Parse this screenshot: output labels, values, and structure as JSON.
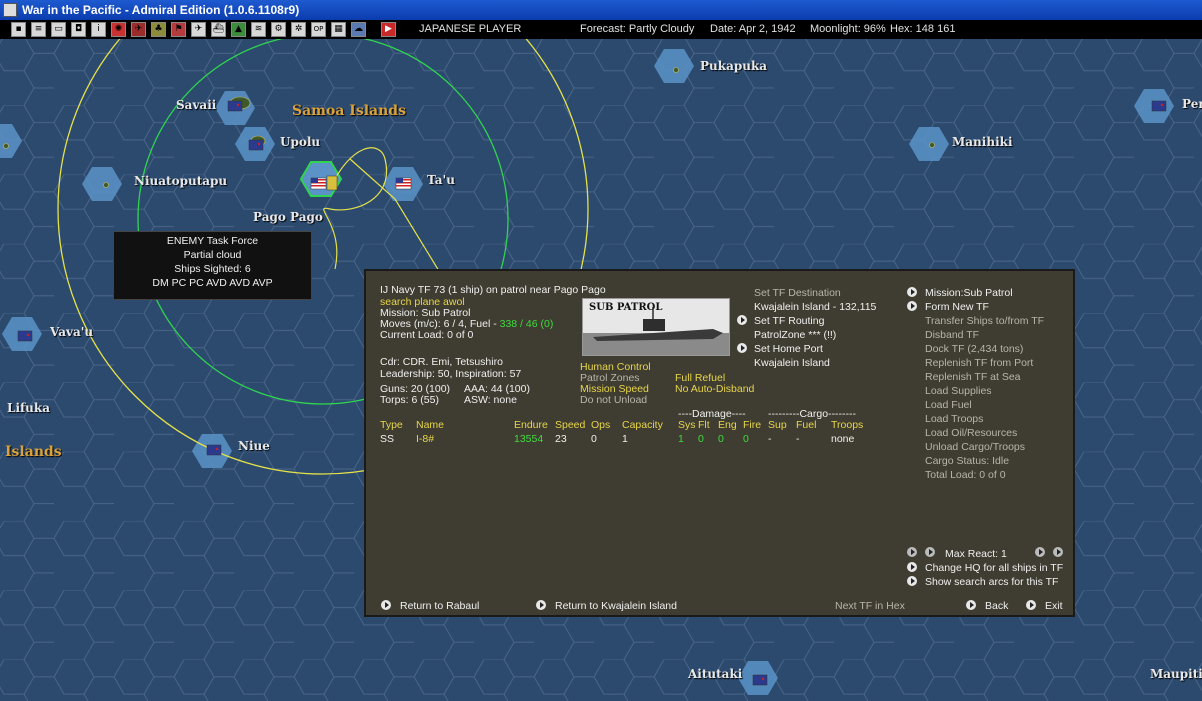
{
  "window": {
    "title": "War in the Pacific - Admiral Edition (1.0.6.1108r9)"
  },
  "toolbar": {
    "player": "JAPANESE PLAYER",
    "forecast": "Forecast: Partly Cloudy",
    "date": "Date: Apr 2, 1942",
    "moonlight": "Moonlight: 96%",
    "hex": "Hex: 148 161"
  },
  "map": {
    "labels": {
      "savaii": "Savaii",
      "samoa": "Samoa Islands",
      "upolu": "Upolu",
      "niuatoputapu": "Niuatoputapu",
      "tau": "Ta'u",
      "pago_pago": "Pago Pago",
      "pukapuka": "Pukapuka",
      "manihiki": "Manihiki",
      "per": "Pen",
      "vavau": "Vava'u",
      "lifuka": "Lifuka",
      "islands": "Islands",
      "niue": "Niue",
      "aitutaki": "Aitutaki",
      "maupiti": "Maupiti"
    }
  },
  "tooltip": {
    "line1": "ENEMY Task Force",
    "line2": "Partial cloud",
    "line3": "Ships Sighted: 6",
    "line4": "DM PC PC AVD AVD AVP"
  },
  "tf_panel": {
    "header": "IJ Navy TF 73 (1 ship)  on patrol near Pago Pago",
    "status": "search plane awol",
    "mission": "Mission: Sub Patrol",
    "moves_prefix": "Moves (m/c): 6 / 4, Fuel - ",
    "fuel": "338 / 46 (0)",
    "current_load": "Current Load:  0 of 0",
    "cdr": "Cdr: CDR. Emi, Tetsushiro",
    "leadership": "Leadership: 50, Inspiration: 57",
    "guns": "Guns: 20 (100)",
    "aaa": "AAA: 44 (100)",
    "torps": "Torps: 6 (55)",
    "asw": "ASW: none",
    "image_label": "SUB PATROL",
    "opt_human": "Human Control",
    "opt_patrol": "Patrol Zones",
    "opt_speed": "Mission Speed",
    "opt_unload": "Do not Unload",
    "opt_refuel": "Full Refuel",
    "opt_disband": "No Auto-Disband",
    "dest_title": "Set TF Destination",
    "dest": "Kwajalein Island - 132,115",
    "routing": "Set TF Routing",
    "patrol_zone": "PatrolZone *** (!!)",
    "home_port": "Set Home Port",
    "home": "Kwajalein Island",
    "right_menu": [
      "Mission:Sub Patrol",
      "Form New TF",
      "Transfer Ships to/from TF",
      "Disband TF",
      "Dock TF (2,434 tons)",
      "Replenish TF from Port",
      "Replenish TF at Sea",
      "Load Supplies",
      "Load Fuel",
      "Load Troops",
      "Load Oil/Resources",
      "Unload Cargo/Troops",
      "Cargo Status: Idle",
      "Total Load: 0 of 0"
    ],
    "damage_header": "----Damage----",
    "cargo_header": "---------Cargo--------",
    "columns": [
      "Type",
      "Name",
      "Endure",
      "Speed",
      "Ops",
      "Capacity",
      "Sys",
      "Flt",
      "Eng",
      "Fire",
      "Sup",
      "Fuel",
      "Troops"
    ],
    "row": [
      "SS",
      "I-8#",
      "13554",
      "23",
      "0",
      "1",
      "1",
      "0",
      "0",
      "0",
      "-",
      "-",
      "none"
    ],
    "max_react": "Max React:  1",
    "change_hq": "Change HQ for all ships in TF",
    "show_arcs": "Show search arcs for this TF",
    "return_rabaul": "Return to Rabaul",
    "return_kwaj": "Return to Kwajalein Island",
    "next_tf": "Next TF in Hex",
    "back": "Back",
    "exit": "Exit"
  },
  "colors": {
    "ocean": "#2c4a6e",
    "panel": "#3f3c31",
    "mission_text": "#e7d64a",
    "good_value": "#3ddc3d",
    "arc_green": "#2fd44f",
    "arc_yellow": "#e5e14a"
  }
}
